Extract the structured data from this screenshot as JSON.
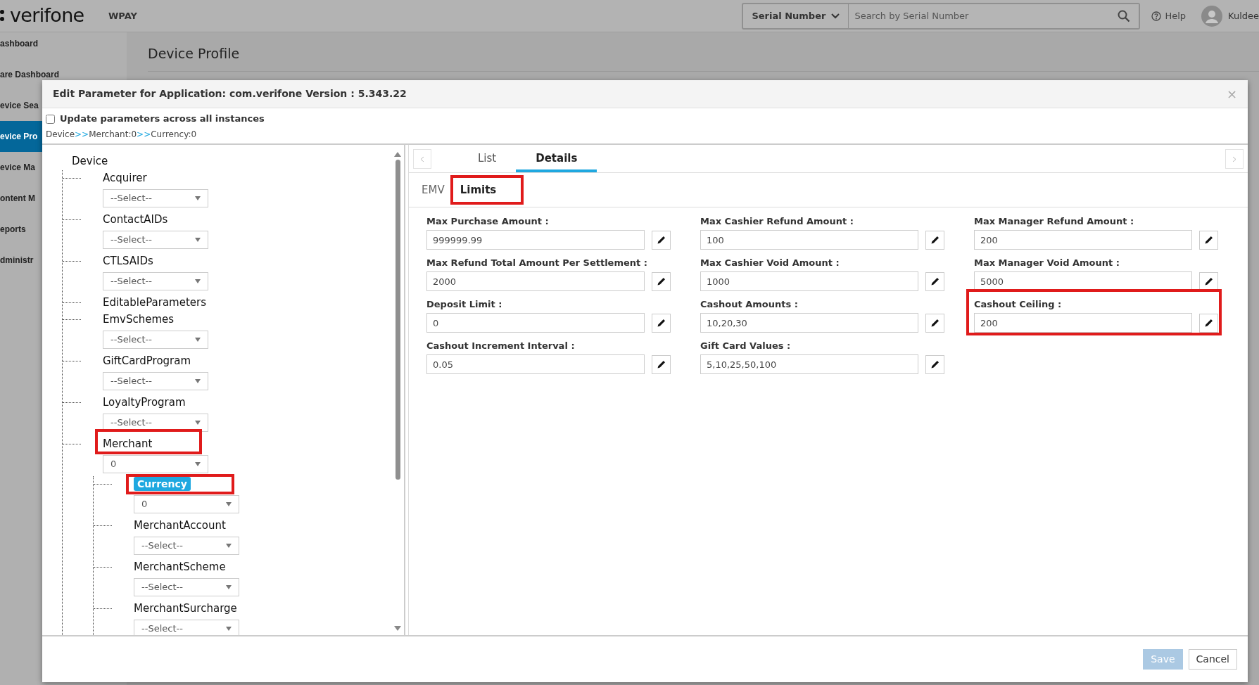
{
  "header": {
    "logo": "verifone",
    "app_name": "WPAY",
    "search_type": "Serial Number",
    "search": {
      "placeholder": "Search by Serial Number"
    },
    "help": "Help",
    "user": "Kuldee"
  },
  "sidebar": {
    "items": [
      {
        "label": "ashboard",
        "selected": false
      },
      {
        "label": "are Dashboard",
        "selected": false
      },
      {
        "label": "evice Sea",
        "selected": false
      },
      {
        "label": "evice Pro",
        "selected": true
      },
      {
        "label": "evice Ma",
        "selected": false
      },
      {
        "label": "ontent M",
        "selected": false
      },
      {
        "label": "eports",
        "selected": false
      },
      {
        "label": "dministr",
        "selected": false
      }
    ]
  },
  "page_title": "Device Profile",
  "dialog": {
    "title": "Edit Parameter for Application: com.verifone Version : 5.343.22",
    "close": "×",
    "update_all": {
      "label": "Update parameters across all instances",
      "checked": false
    },
    "breadcrumb": {
      "separator": ">>",
      "items": [
        "Device",
        "Merchant:0",
        "Currency:0"
      ]
    },
    "tree": [
      {
        "label": "Device",
        "selected": false,
        "highlighted": false,
        "children": [
          {
            "label": "Acquirer",
            "value": "--Select--",
            "selected": false,
            "highlighted": false
          },
          {
            "label": "ContactAIDs",
            "value": "--Select--",
            "selected": false,
            "highlighted": false
          },
          {
            "label": "CTLSAIDs",
            "value": "--Select--",
            "selected": false,
            "highlighted": false
          },
          {
            "label": "EditableParameters",
            "selected": false,
            "highlighted": false
          },
          {
            "label": "EmvSchemes",
            "value": "--Select--",
            "selected": false,
            "highlighted": false
          },
          {
            "label": "GiftCardProgram",
            "value": "--Select--",
            "selected": false,
            "highlighted": false
          },
          {
            "label": "LoyaltyProgram",
            "value": "--Select--",
            "selected": false,
            "highlighted": false
          },
          {
            "label": "Merchant",
            "value": "0",
            "selected": false,
            "highlighted": true,
            "children": [
              {
                "label": "Currency",
                "value": "0",
                "selected": true,
                "highlighted": true
              },
              {
                "label": "MerchantAccount",
                "value": "--Select--",
                "selected": false,
                "highlighted": false
              },
              {
                "label": "MerchantScheme",
                "value": "--Select--",
                "selected": false,
                "highlighted": false
              },
              {
                "label": "MerchantSurcharge",
                "value": "--Select--",
                "selected": false,
                "highlighted": false
              }
            ]
          }
        ]
      }
    ],
    "tabs": [
      {
        "label": "List",
        "selected": false
      },
      {
        "label": "Details",
        "selected": true
      }
    ],
    "subtabs": [
      {
        "label": "EMV",
        "selected": false,
        "highlighted": false
      },
      {
        "label": "Limits",
        "selected": true,
        "highlighted": true
      }
    ],
    "fields": [
      {
        "label": "Max Purchase Amount :",
        "value": "999999.99",
        "highlighted": false
      },
      {
        "label": "Max Cashier Refund Amount :",
        "value": "100",
        "highlighted": false
      },
      {
        "label": "Max Manager Refund Amount :",
        "value": "200",
        "highlighted": false
      },
      {
        "label": "Max Refund Total Amount Per Settlement :",
        "value": "2000",
        "highlighted": false
      },
      {
        "label": "Max Cashier Void Amount :",
        "value": "1000",
        "highlighted": false
      },
      {
        "label": "Max Manager Void Amount :",
        "value": "5000",
        "highlighted": false
      },
      {
        "label": "Deposit Limit :",
        "value": "0",
        "highlighted": false
      },
      {
        "label": "Cashout Amounts :",
        "value": "10,20,30",
        "highlighted": false
      },
      {
        "label": "Cashout Ceiling :",
        "value": "200",
        "highlighted": true
      },
      {
        "label": "Cashout Increment Interval :",
        "value": "0.05",
        "highlighted": false
      },
      {
        "label": "Gift Card Values :",
        "value": "5,10,25,50,100",
        "highlighted": false
      }
    ],
    "buttons": [
      {
        "label": "Save",
        "disabled": true
      },
      {
        "label": "Cancel",
        "disabled": false
      }
    ]
  }
}
